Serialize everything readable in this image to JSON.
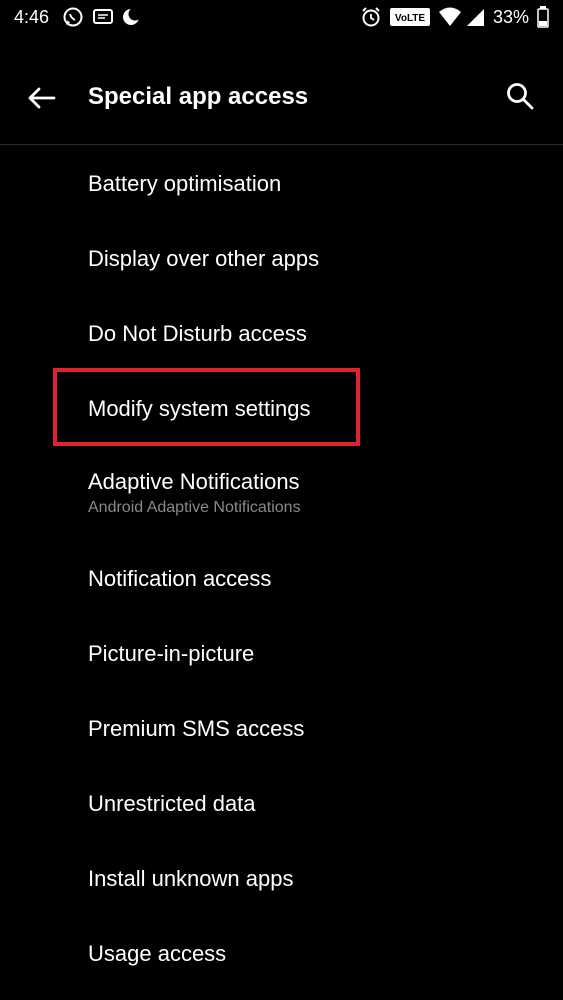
{
  "status_bar": {
    "time": "4:46",
    "battery_percent": "33%",
    "icons_left": [
      "whatsapp-icon",
      "message-icon",
      "moon-icon"
    ],
    "icons_right": [
      "alarm-icon",
      "volte-icon",
      "wifi-icon",
      "signal-icon",
      "battery-icon"
    ],
    "volte_label": "VoLTE"
  },
  "app_bar": {
    "title": "Special app access",
    "back_icon": "arrow-left-icon",
    "search_icon": "search-icon"
  },
  "items": [
    {
      "label": "Battery optimisation"
    },
    {
      "label": "Display over other apps"
    },
    {
      "label": "Do Not Disturb access"
    },
    {
      "label": "Modify system settings"
    },
    {
      "label": "Adaptive Notifications",
      "sub": "Android Adaptive Notifications"
    },
    {
      "label": "Notification access"
    },
    {
      "label": "Picture-in-picture"
    },
    {
      "label": "Premium SMS access"
    },
    {
      "label": "Unrestricted data"
    },
    {
      "label": "Install unknown apps"
    },
    {
      "label": "Usage access"
    }
  ],
  "colors": {
    "background": "#000000",
    "text": "#ffffff",
    "secondary_text": "#8a8a8a",
    "highlight": "#e0232e"
  }
}
